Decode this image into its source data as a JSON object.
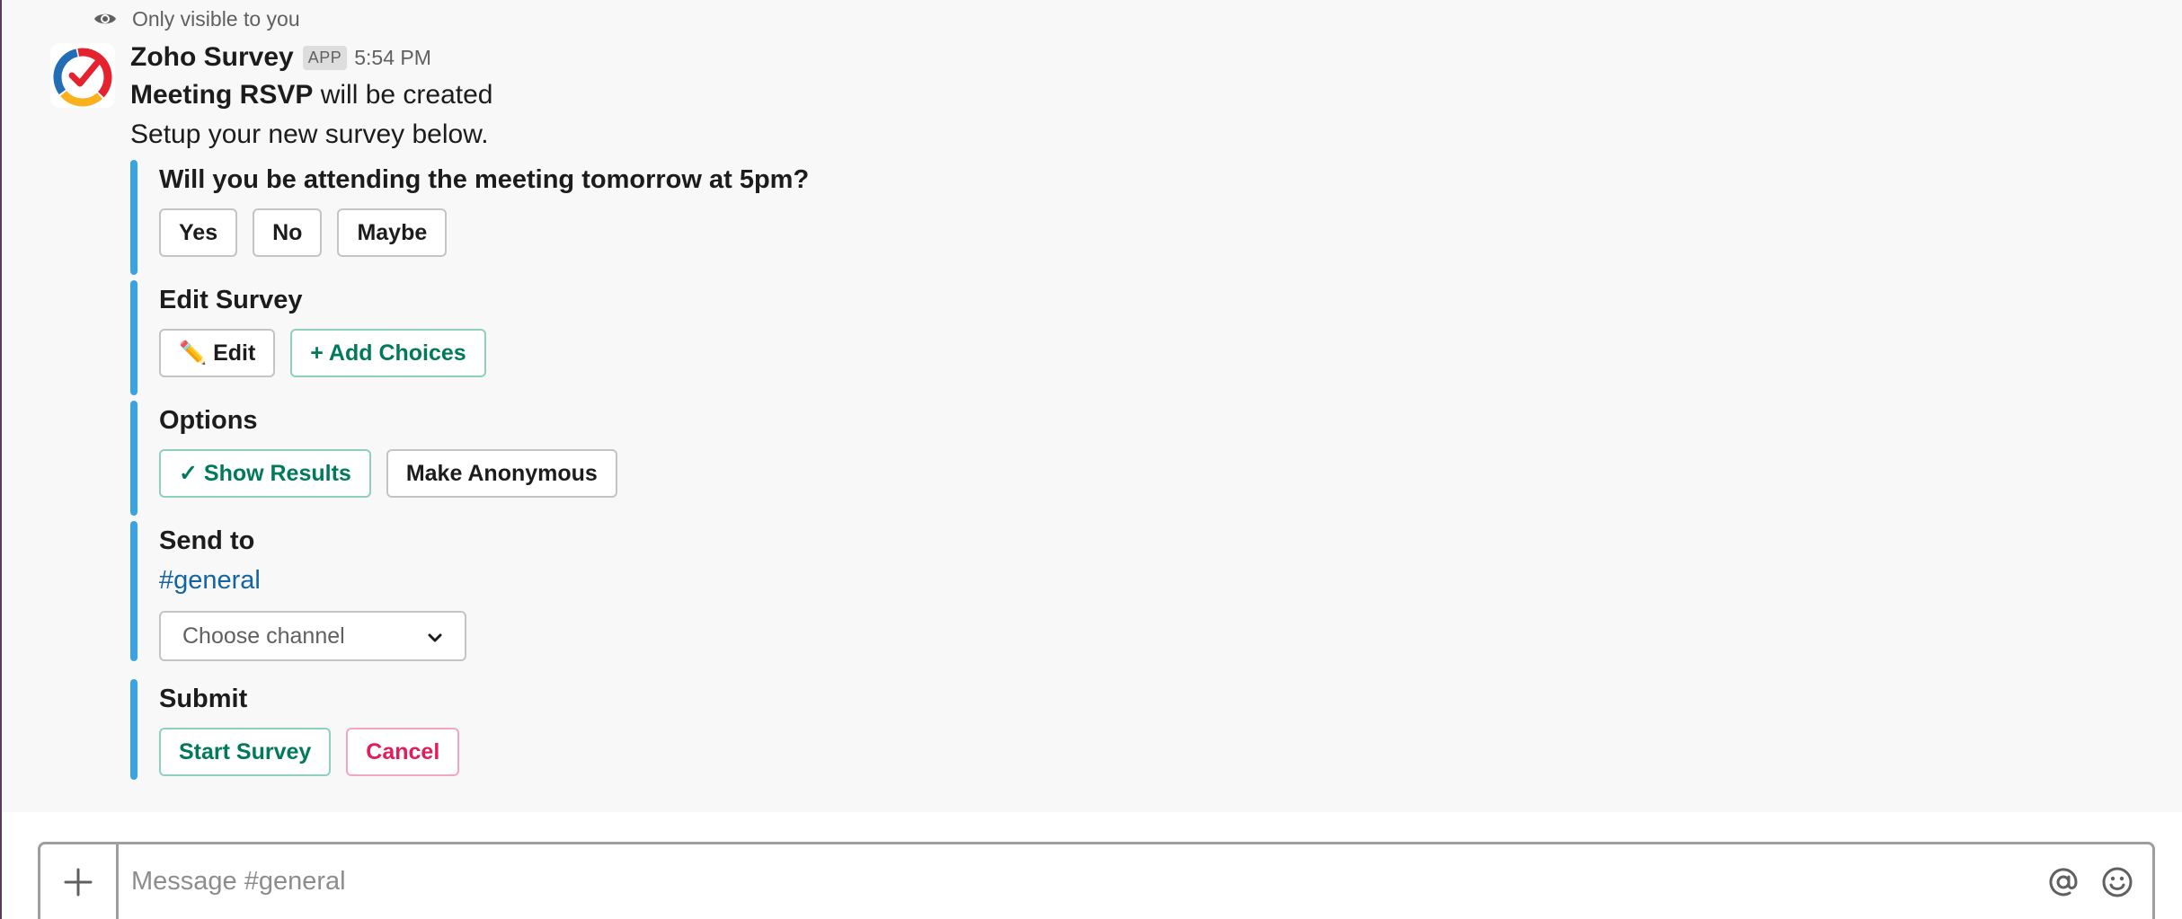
{
  "ephemeral": {
    "text": "Only visible to you",
    "icon": "eye-icon"
  },
  "message": {
    "sender": "Zoho Survey",
    "badge": "APP",
    "time": "5:54 PM",
    "title_bold": "Meeting RSVP",
    "title_rest": " will be created",
    "subtitle": "Setup your new survey below."
  },
  "blocks": {
    "question": {
      "title": "Will you be attending the meeting tomorrow at 5pm?",
      "choices": [
        "Yes",
        "No",
        "Maybe"
      ]
    },
    "edit": {
      "title": "Edit Survey",
      "edit_label": "✏️ Edit",
      "add_label": "+ Add Choices"
    },
    "options": {
      "title": "Options",
      "show_results": "✓ Show Results",
      "anonymous": "Make Anonymous"
    },
    "send": {
      "title": "Send to",
      "channel": "#general",
      "select_placeholder": "Choose channel"
    },
    "submit": {
      "title": "Submit",
      "start": "Start Survey",
      "cancel": "Cancel"
    }
  },
  "composer": {
    "placeholder": "Message #general"
  },
  "colors": {
    "accent_bar": "#3aa3e3",
    "green": "#007a5a",
    "red": "#e01e5a",
    "link": "#1264a3"
  }
}
